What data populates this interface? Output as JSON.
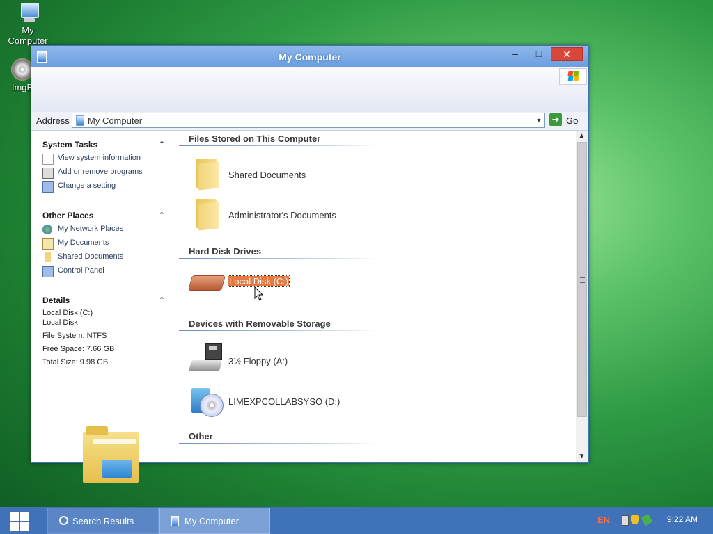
{
  "desktop": {
    "icons": [
      {
        "label": "My Computer"
      },
      {
        "label": "ImgB"
      }
    ]
  },
  "window": {
    "title": "My Computer",
    "address": {
      "label": "Address",
      "value": "My Computer",
      "go_label": "Go"
    },
    "task_pane": {
      "system_tasks": {
        "title": "System Tasks",
        "items": [
          {
            "label": "View system information",
            "icon": "system-info-icon"
          },
          {
            "label": "Add or remove programs",
            "icon": "add-remove-icon"
          },
          {
            "label": "Change a setting",
            "icon": "control-panel-icon"
          }
        ]
      },
      "other_places": {
        "title": "Other Places",
        "items": [
          {
            "label": "My Network Places",
            "icon": "network-icon"
          },
          {
            "label": "My Documents",
            "icon": "documents-icon"
          },
          {
            "label": "Shared Documents",
            "icon": "folder-icon"
          },
          {
            "label": "Control Panel",
            "icon": "control-panel-icon"
          }
        ]
      },
      "details": {
        "title": "Details",
        "name": "Local Disk (C:)",
        "type": "Local Disk",
        "file_system": "File System: NTFS",
        "free_space": "Free Space: 7.66 GB",
        "total_size": "Total Size: 9.98 GB"
      }
    },
    "groups": [
      {
        "title": "Files Stored on This Computer",
        "items": [
          "Shared Documents",
          "Administrator's Documents"
        ]
      },
      {
        "title": "Hard Disk Drives",
        "items": [
          "Local Disk (C:)"
        ]
      },
      {
        "title": "Devices with Removable Storage",
        "items": [
          "3½ Floppy (A:)",
          "LIMEXPCOLLABSYSO (D:)"
        ]
      },
      {
        "title": "Other",
        "items": []
      }
    ],
    "selected_item": "Local Disk (C:)"
  },
  "taskbar": {
    "buttons": [
      {
        "label": "Search Results"
      },
      {
        "label": "My Computer"
      }
    ],
    "tray": {
      "language": "EN",
      "time": "9:22 AM"
    }
  },
  "colors": {
    "titlebar": "#6a9ddf",
    "taskbar": "#3f72b8",
    "selection": "#e6793f",
    "close_button": "#d9463a"
  }
}
